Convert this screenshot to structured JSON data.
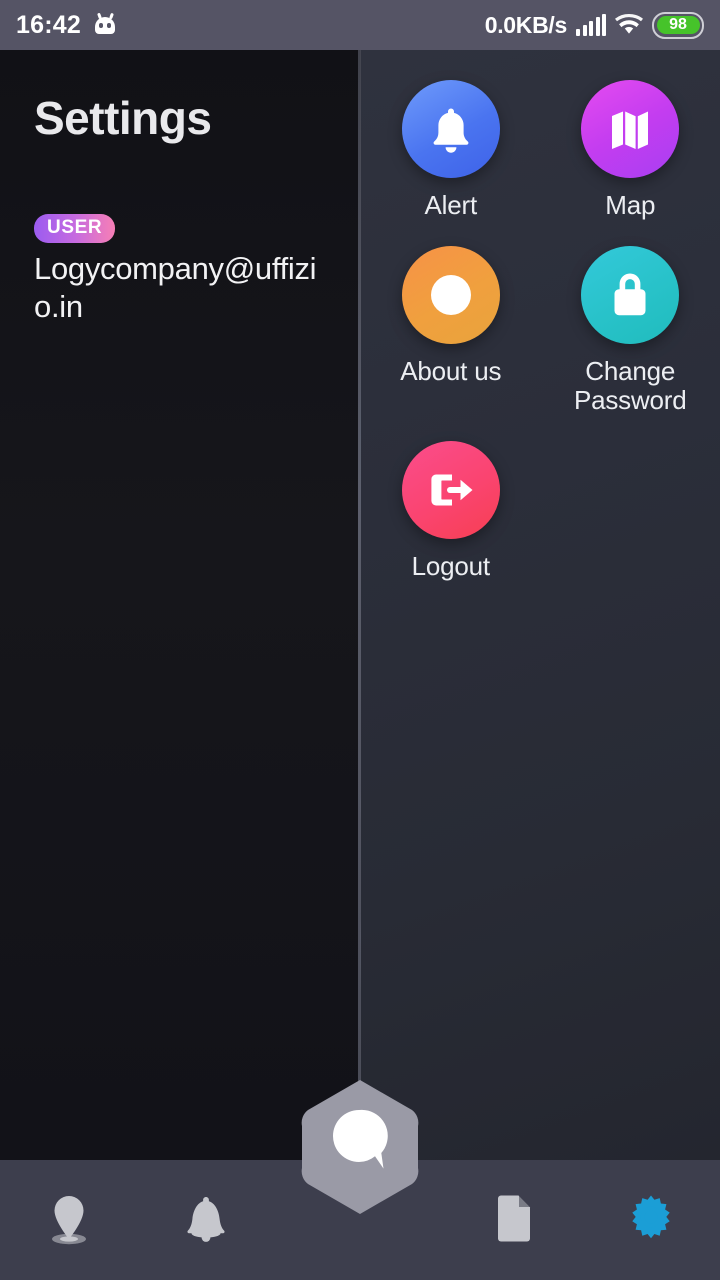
{
  "statusbar": {
    "time": "16:42",
    "robot_icon": "android-robot-icon",
    "network_speed": "0.0KB/s",
    "signal_icon": "signal-bars-icon",
    "wifi_icon": "wifi-icon",
    "battery_level": "98",
    "battery_color": "#46c32a"
  },
  "drawer": {
    "title": "Settings",
    "user_badge": "USER",
    "user_email": "Logycompany@uffizio.in",
    "badge_gradient_from": "#9b5cf0",
    "badge_gradient_to": "#f77fb5"
  },
  "menu": {
    "items": [
      {
        "label": "Alert",
        "icon": "bell-icon",
        "color": "#4a74f0"
      },
      {
        "label": "Map",
        "icon": "map-icon",
        "color": "#c43df0"
      },
      {
        "label": "About us",
        "icon": "info-icon",
        "color": "#f0a03e"
      },
      {
        "label": "Change Password",
        "icon": "lock-refresh-icon",
        "color": "#28c2c9"
      },
      {
        "label": "Logout",
        "icon": "sign-out-icon",
        "color": "#fa4470"
      }
    ]
  },
  "bottomnav": {
    "items": [
      {
        "name": "location",
        "icon": "map-pin-icon",
        "active": false
      },
      {
        "name": "alerts",
        "icon": "bell-icon",
        "active": false
      },
      {
        "name": "chat",
        "icon": "chat-bubble-icon",
        "active": false
      },
      {
        "name": "reports",
        "icon": "report-chart-icon",
        "active": false
      },
      {
        "name": "settings",
        "icon": "gear-icon",
        "active": true
      }
    ],
    "active_color": "#1b9ed6",
    "inactive_color": "#c6c7cd"
  }
}
